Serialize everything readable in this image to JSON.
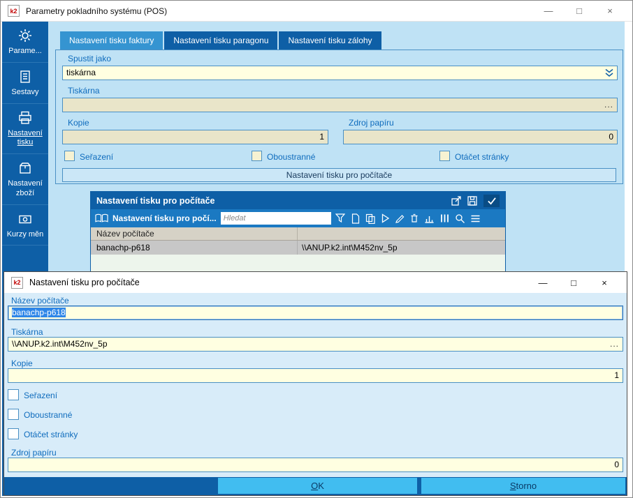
{
  "window": {
    "title": "Parametry pokladního systému (POS)",
    "icon_text": "k2",
    "controls": {
      "minimize": "—",
      "maximize": "□",
      "close": "×"
    }
  },
  "sidebar": {
    "items": [
      {
        "label": "Parame...",
        "icon": "gear-icon"
      },
      {
        "label": "Sestavy",
        "icon": "reports-icon"
      },
      {
        "label": "Nastavení tisku",
        "icon": "printer-icon"
      },
      {
        "label": "Nastavení zboží",
        "icon": "goods-icon"
      },
      {
        "label": "Kurzy měn",
        "icon": "currency-icon"
      }
    ],
    "selected": "Nastavení tisku"
  },
  "tabs": [
    {
      "label": "Nastavení tisku faktury",
      "active": true
    },
    {
      "label": "Nastavení tisku paragonu",
      "active": false
    },
    {
      "label": "Nastavení tisku zálohy",
      "active": false
    }
  ],
  "form": {
    "spustit_jako_label": "Spustit jako",
    "spustit_jako_value": "tiskárna",
    "tiskarna_label": "Tiskárna",
    "tiskarna_value": "",
    "kopie_label": "Kopie",
    "kopie_value": "1",
    "zdroj_label": "Zdroj papíru",
    "zdroj_value": "0",
    "browse": "...",
    "checkboxes": [
      {
        "label": "Seřazení",
        "checked": false
      },
      {
        "label": "Oboustranné",
        "checked": false
      },
      {
        "label": "Otáčet stránky",
        "checked": false
      }
    ],
    "computers_button": "Nastavení tisku pro počítače"
  },
  "panel": {
    "title": "Nastavení tisku pro počítače",
    "title_icons": [
      "popup-icon",
      "save-icon",
      "confirm-icon"
    ],
    "toolbar": {
      "caption": "Nastavení tisku pro počí...",
      "search_placeholder": "Hledat",
      "icons": [
        "book-icon",
        "filter-icon",
        "new-record-icon",
        "copy-icon",
        "run-icon",
        "edit-icon",
        "delete-icon",
        "chart-icon",
        "columns-icon",
        "search-settings-icon",
        "menu-icon"
      ]
    },
    "grid": {
      "columns": [
        "Název počítače",
        ""
      ],
      "rows": [
        {
          "computer": "banachp-p618",
          "printer": "\\\\ANUP.k2.int\\M452nv_5p"
        }
      ]
    }
  },
  "dialog": {
    "title": "Nastavení tisku pro počítače",
    "icon_text": "k2",
    "controls": {
      "minimize": "—",
      "maximize": "□",
      "close": "×"
    },
    "nazev_label": "Název počítače",
    "nazev_value": "banachp-p618",
    "tiskarna_label": "Tiskárna",
    "tiskarna_value": "\\\\ANUP.k2.int\\M452nv_5p",
    "kopie_label": "Kopie",
    "kopie_value": "1",
    "checkboxes": [
      {
        "label": "Seřazení",
        "checked": false
      },
      {
        "label": "Oboustranné",
        "checked": false
      },
      {
        "label": "Otáčet stránky",
        "checked": false
      }
    ],
    "zdroj_label": "Zdroj papíru",
    "zdroj_value": "0",
    "browse": "...",
    "ok_button": "OK",
    "storno_button": "Storno"
  },
  "colors": {
    "sidebar_blue": "#0E5FA6",
    "active_tab_blue": "#3594D1",
    "toolbar_blue": "#1B79C2",
    "main_bg": "#BFE2F5",
    "dialog_bg": "#D8ECF9",
    "input_bg": "#FFFFE1",
    "input_disabled_bg": "#E9E5C9",
    "selection_blue": "#2E86E8",
    "button_cyan": "#41BDF0",
    "label_blue": "#0F6CBD"
  }
}
